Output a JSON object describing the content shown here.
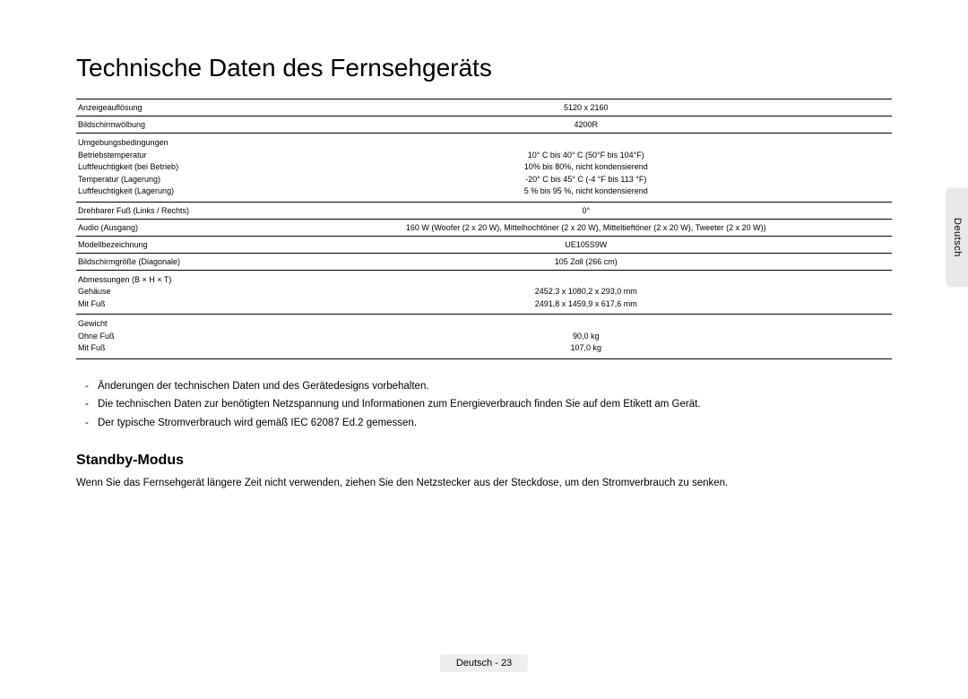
{
  "title": "Technische Daten des Fernsehgeräts",
  "specs": {
    "row0": {
      "label": "Anzeigeauflösung",
      "value": "5120 x 2160"
    },
    "row1": {
      "label": "Bildschirmwölbung",
      "value": "4200R"
    },
    "row2": {
      "l0": "Umgebungsbedingungen",
      "l1": "Betriebstemperatur",
      "l2": "Luftfeuchtigkeit (bei Betrieb)",
      "l3": "Temperatur (Lagerung)",
      "l4": "Luftfeuchtigkeit (Lagerung)",
      "v0": "",
      "v1": "10° C bis 40° C (50°F bis 104°F)",
      "v2": "10% bis 80%, nicht kondensierend",
      "v3": "-20° C bis 45° C (-4 °F bis 113 °F)",
      "v4": "5 % bis 95 %, nicht kondensierend"
    },
    "row3": {
      "label": "Drehbarer Fuß (Links / Rechts)",
      "value": "0°"
    },
    "row4": {
      "label": "Audio (Ausgang)",
      "value": "160 W (Woofer (2 x 20 W), Mittelhochtöner (2 x 20 W), Mitteltieftöner (2 x 20 W), Tweeter (2 x 20 W))"
    },
    "row5": {
      "label": "Modellbezeichnung",
      "value": "UE105S9W"
    },
    "row6": {
      "label": "Bildschirmgröße (Diagonale)",
      "value": "105 Zoll (266 cm)"
    },
    "row7": {
      "l0": "Abmessungen (B × H × T)",
      "l1": "Gehäuse",
      "l2": "Mit Fuß",
      "v0": "",
      "v1": "2452,3 x 1080,2 x 293,0 mm",
      "v2": "2491,8 x 1459,9 x 617,6 mm"
    },
    "row8": {
      "l0": "Gewicht",
      "l1": "Ohne Fuß",
      "l2": "Mit Fuß",
      "v0": "",
      "v1": "90,0 kg",
      "v2": "107,0 kg"
    }
  },
  "notes": {
    "n0": "Änderungen der technischen Daten und des Gerätedesigns vorbehalten.",
    "n1": "Die technischen Daten zur benötigten Netzspannung und Informationen zum Energieverbrauch finden Sie auf dem Etikett am Gerät.",
    "n2": "Der typische Stromverbrauch wird gemäß IEC 62087 Ed.2 gemessen."
  },
  "standby": {
    "heading": "Standby-Modus",
    "text": "Wenn Sie das Fernsehgerät längere Zeit nicht verwenden, ziehen Sie den Netzstecker aus der Steckdose, um den Stromverbrauch zu senken."
  },
  "sideTab": "Deutsch",
  "footer": "Deutsch - 23"
}
